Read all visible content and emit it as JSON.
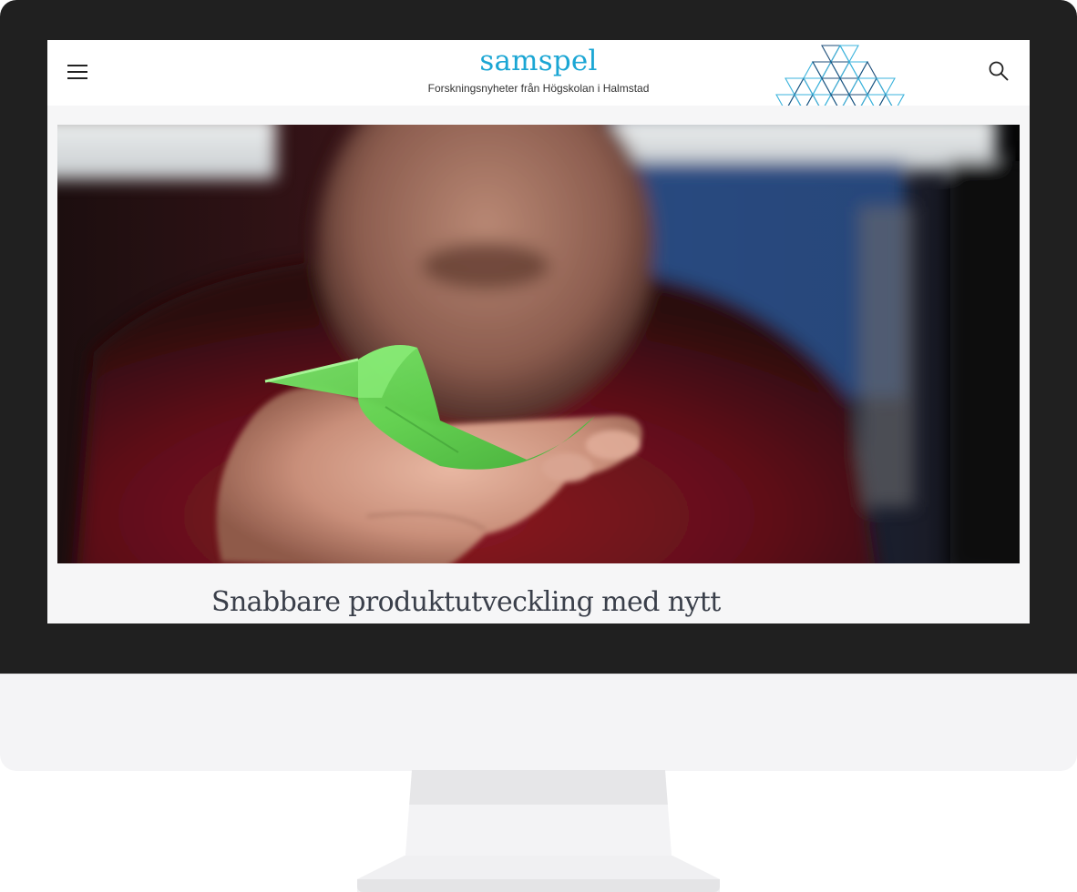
{
  "site": {
    "logo": "samspel",
    "tagline": "Forskningsnyheter från Högskolan i Halmstad"
  },
  "header": {
    "menu_icon": "hamburger-menu-icon",
    "search_icon": "search-icon"
  },
  "article": {
    "headline": "Snabbare produktutveckling med nytt"
  },
  "colors": {
    "brand": "#1ba6d4",
    "headline": "#3a3f4a",
    "pattern_dark": "#1d4e7a",
    "pattern_light": "#3bb3dc"
  }
}
